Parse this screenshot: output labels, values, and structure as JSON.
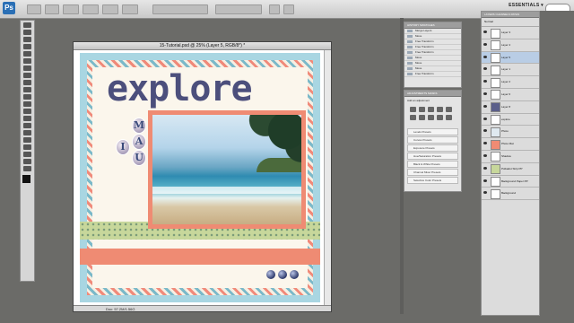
{
  "app": {
    "logo": "Ps",
    "workspace": "ESSENTIALS ▾"
  },
  "document": {
    "title": "15-Tutorial.psd @ 25% (Layer 5, RGB/8*) *",
    "status": "Doc: 57.2M/1.56G"
  },
  "artwork": {
    "headline": "explore",
    "letters": [
      "M",
      "A",
      "U",
      "I"
    ]
  },
  "history_panel": {
    "tabs": "HISTORY  SWATCHES",
    "rows": [
      "Merge Layers",
      "Move",
      "Free Transform",
      "Free Transform",
      "Free Transform",
      "Move",
      "Move",
      "Move",
      "Free Transform"
    ]
  },
  "adjustments_panel": {
    "tabs": "ADJUSTMENTS  MASKS",
    "header": "Add an adjustment",
    "presets": [
      "Levels Presets",
      "Curves Presets",
      "Exposure Presets",
      "Hue/Saturation Presets",
      "Black & White Presets",
      "Channel Mixer Presets",
      "Selective Color Presets"
    ]
  },
  "layers_panel": {
    "tabs": "LAYERS  CHANNELS  PATHS",
    "blend": "Normal",
    "rows": [
      "Layer 3",
      "Layer 4",
      "Layer 5",
      "Layer 1",
      "Layer 2",
      "Layer 6",
      "Layer 8",
      "explore",
      "Photo",
      "Photo Mat",
      "Shadow",
      "Polkadot Strip PP",
      "Background Paper PP",
      "Background"
    ],
    "selected_index": 2
  },
  "colors": {
    "coral": "#ef8b73",
    "navy": "#4c4f7c",
    "sky": "#a9d6e2"
  }
}
